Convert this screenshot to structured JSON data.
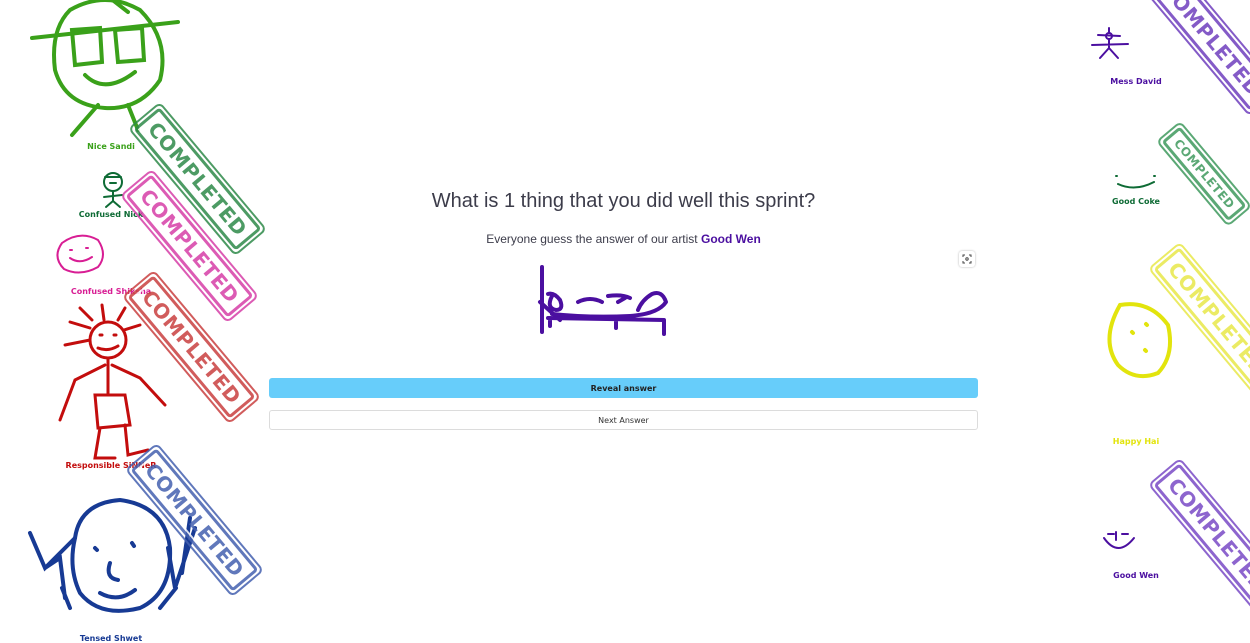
{
  "question": "What is 1 thing that you did well this sprint?",
  "subtitle_prefix": "Everyone guess the answer of our artist",
  "artist": "Good Wen",
  "buttons": {
    "reveal": "Reveal answer",
    "next": "Next Answer"
  },
  "stamp_text": "COMPLETED",
  "colors": {
    "reveal": "#67cdfa",
    "artist": "#4b0fa0"
  },
  "players_left": [
    {
      "name": "Nice Sandi",
      "color": "#3aa11a",
      "completed": true
    },
    {
      "name": "Confused Nick",
      "color": "#0e6b35",
      "completed": true
    },
    {
      "name": "Confused Shiksha",
      "color": "#d81e94",
      "completed": true
    },
    {
      "name": "Responsible SiNNeR",
      "color": "#c30d0d",
      "completed": true
    },
    {
      "name": "Tensed Shwet",
      "color": "#173a94",
      "completed": true
    }
  ],
  "players_right": [
    {
      "name": "Mess David",
      "color": "#4b0fa0",
      "completed": true
    },
    {
      "name": "Good Coke",
      "color": "#0e6b35",
      "completed": true
    },
    {
      "name": "Happy Hai",
      "color": "#e2e40d",
      "completed": true
    },
    {
      "name": "Good Wen",
      "color": "#4b0fa0",
      "completed": true
    }
  ]
}
